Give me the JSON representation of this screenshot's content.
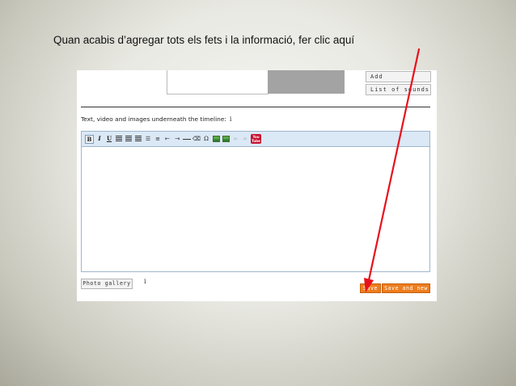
{
  "instruction": "Quan acabis d’agregar tots els fets i la informació, fer clic aquí",
  "side_buttons": {
    "add": "Add",
    "sounds": "List of sounds"
  },
  "section_label": "Text, video and images underneath the timeline:",
  "info_icon": "i",
  "toolbar_icons": [
    "bold-icon",
    "italic-icon",
    "underline-icon",
    "align-left-icon",
    "align-center-icon",
    "align-right-icon",
    "bullet-list-icon",
    "numbered-list-icon",
    "outdent-icon",
    "indent-icon",
    "horizontal-rule-icon",
    "eraser-icon",
    "omega-icon",
    "image-icon",
    "image-add-icon",
    "link-icon",
    "unlink-icon",
    "youtube-icon"
  ],
  "youtube_label": "You Tube",
  "gallery_button": "Photo gallery",
  "save_button": "Save",
  "save_new_button": "Save and new",
  "colors": {
    "arrow": "#e8101c",
    "save": "#ee7d1e",
    "toolbar": "#dbe8f6"
  }
}
